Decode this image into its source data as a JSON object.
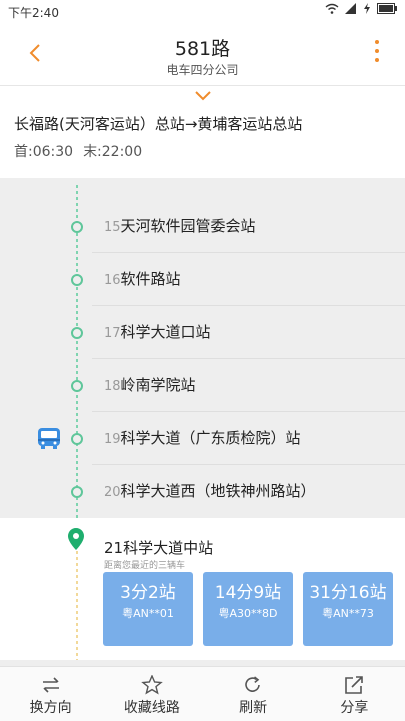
{
  "status_bar": {
    "time": "下午2:40"
  },
  "header": {
    "title": "581路",
    "subtitle": "电车四分公司"
  },
  "route": {
    "direction": "长福路(天河客运站）总站→黄埔客运站总站",
    "first_bus": "首:06:30",
    "last_bus": "末:22:00"
  },
  "stations": [
    {
      "num": "15",
      "name": "天河软件园管委会站"
    },
    {
      "num": "16",
      "name": "软件路站"
    },
    {
      "num": "17",
      "name": "科学大道口站"
    },
    {
      "num": "18",
      "name": "岭南学院站"
    },
    {
      "num": "19",
      "name": "科学大道（广东质检院）站"
    },
    {
      "num": "20",
      "name": "科学大道西（地铁神州路站）"
    }
  ],
  "current_station": {
    "label": "21科学大道中站",
    "hint": "距离您最近的三辆车",
    "buses": [
      {
        "eta": "3分2站",
        "plate": "粤AN**01"
      },
      {
        "eta": "14分9站",
        "plate": "粤A30**8D"
      },
      {
        "eta": "31分16站",
        "plate": "粤AN**73"
      }
    ]
  },
  "tabs": [
    {
      "label": "换方向",
      "icon": "swap-icon"
    },
    {
      "label": "收藏线路",
      "icon": "star-icon"
    },
    {
      "label": "刷新",
      "icon": "refresh-icon"
    },
    {
      "label": "分享",
      "icon": "share-icon"
    }
  ],
  "colors": {
    "accent": "#f08c2c",
    "card": "#79aee9",
    "line": "#5fc69a"
  }
}
